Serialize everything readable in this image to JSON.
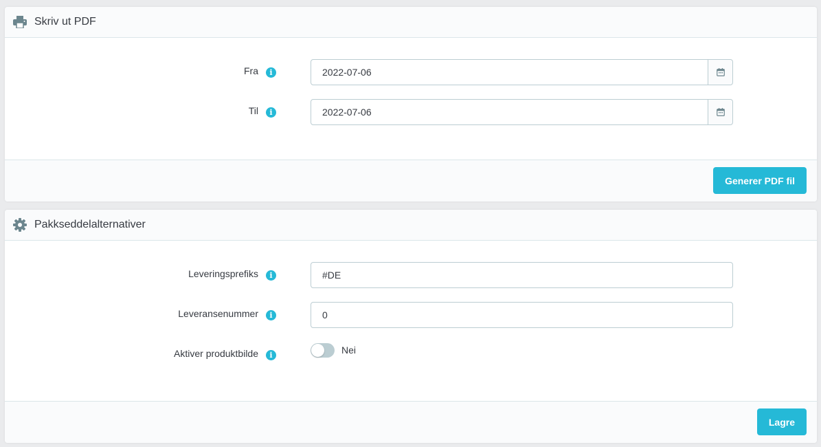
{
  "colors": {
    "accent": "#25b9d7",
    "text": "#363a41",
    "border": "#bbcdd2",
    "background": "#eaebed"
  },
  "pdf_panel": {
    "title": "Skriv ut PDF",
    "icon": "printer-icon",
    "fields": {
      "from": {
        "label": "Fra",
        "value": "2022-07-06"
      },
      "to": {
        "label": "Til",
        "value": "2022-07-06"
      }
    },
    "generate_button": "Generer PDF fil"
  },
  "options_panel": {
    "title": "Pakkseddelalternativer",
    "icon": "gear-icon",
    "fields": {
      "prefix": {
        "label": "Leveringsprefiks",
        "value": "#DE"
      },
      "number": {
        "label": "Leveransenummer",
        "value": "0"
      },
      "product_image": {
        "label": "Aktiver produktbilde",
        "state": "Nei",
        "enabled": false
      }
    },
    "save_button": "Lagre"
  }
}
